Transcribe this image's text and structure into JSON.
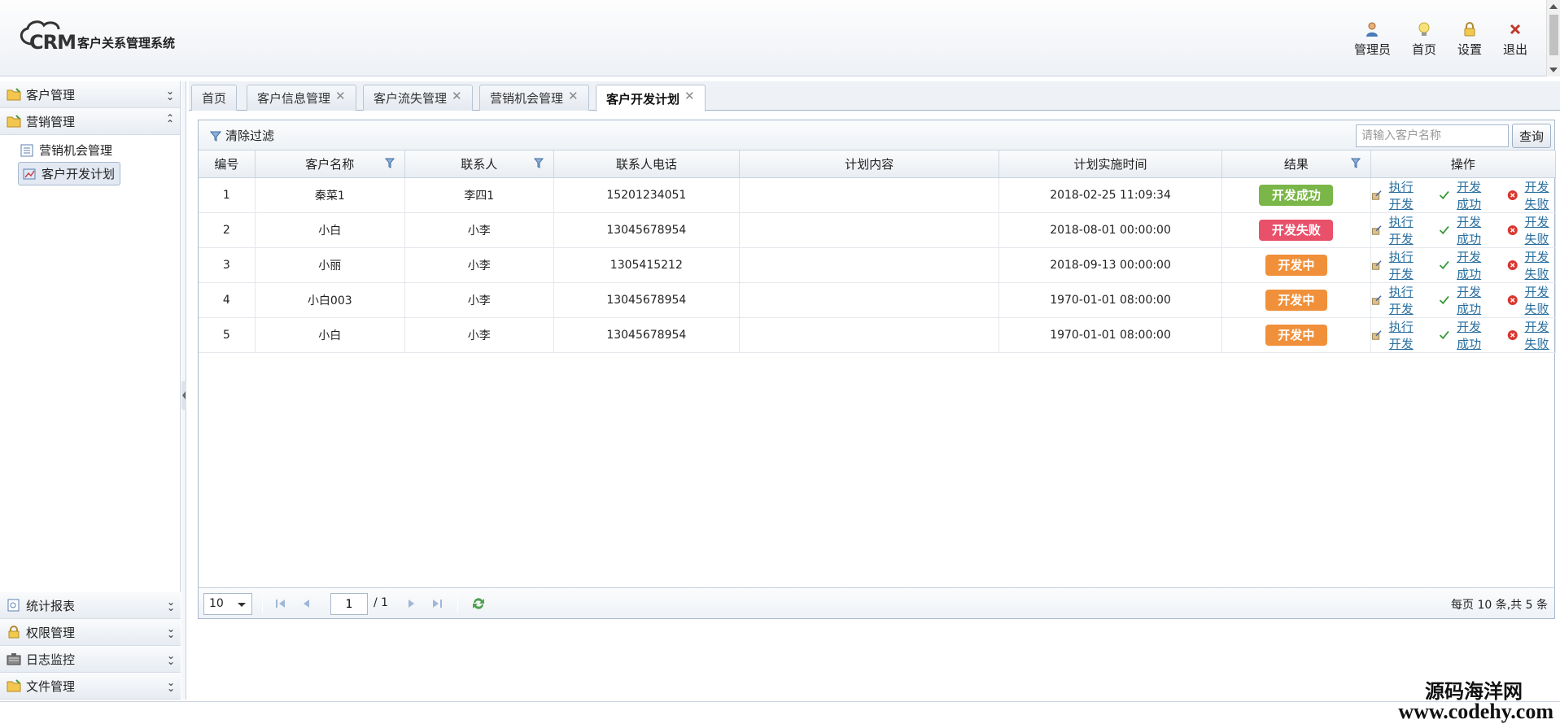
{
  "header": {
    "logo_text": "CRM",
    "system_title": "客户关系管理系统",
    "nav": [
      {
        "label": "管理员",
        "icon": "admin-user-icon"
      },
      {
        "label": "首页",
        "icon": "lightbulb-icon"
      },
      {
        "label": "设置",
        "icon": "lock-icon"
      },
      {
        "label": "退出",
        "icon": "close-x-icon"
      }
    ]
  },
  "sidebar": {
    "groups_top": [
      {
        "label": "客户管理",
        "icon": "folder-icon",
        "expanded": false
      },
      {
        "label": "营销管理",
        "icon": "folder-icon",
        "expanded": true
      }
    ],
    "items": [
      {
        "label": "营销机会管理",
        "icon": "list-icon"
      },
      {
        "label": "客户开发计划",
        "icon": "plan-icon",
        "selected": true
      }
    ],
    "groups_bottom": [
      {
        "label": "统计报表",
        "icon": "report-icon"
      },
      {
        "label": "权限管理",
        "icon": "lock-icon"
      },
      {
        "label": "日志监控",
        "icon": "monitor-icon"
      },
      {
        "label": "文件管理",
        "icon": "folder-icon"
      }
    ]
  },
  "tabs": [
    {
      "label": "首页",
      "closable": false
    },
    {
      "label": "客户信息管理",
      "closable": true
    },
    {
      "label": "客户流失管理",
      "closable": true
    },
    {
      "label": "营销机会管理",
      "closable": true
    },
    {
      "label": "客户开发计划",
      "closable": true,
      "active": true
    }
  ],
  "toolbar": {
    "clear_filter_label": "清除过滤",
    "search_placeholder": "请输入客户名称",
    "search_button": "查询"
  },
  "table": {
    "headers": [
      "编号",
      "客户名称",
      "联系人",
      "联系人电话",
      "计划内容",
      "计划实施时间",
      "结果",
      "操作"
    ],
    "rows": [
      {
        "id": "1",
        "name": "秦菜1",
        "contact": "李四1",
        "phone": "15201234051",
        "content": "",
        "time": "2018-02-25 11:09:34",
        "result": "开发成功",
        "result_color": "#7ab648"
      },
      {
        "id": "2",
        "name": "小白",
        "contact": "小李",
        "phone": "13045678954",
        "content": "",
        "time": "2018-08-01 00:00:00",
        "result": "开发失败",
        "result_color": "#e9506a"
      },
      {
        "id": "3",
        "name": "小丽",
        "contact": "小李",
        "phone": "1305415212",
        "content": "",
        "time": "2018-09-13 00:00:00",
        "result": "开发中",
        "result_color": "#f0903a"
      },
      {
        "id": "4",
        "name": "小白003",
        "contact": "小李",
        "phone": "13045678954",
        "content": "",
        "time": "1970-01-01 08:00:00",
        "result": "开发中",
        "result_color": "#f0903a"
      },
      {
        "id": "5",
        "name": "小白",
        "contact": "小李",
        "phone": "13045678954",
        "content": "",
        "time": "1970-01-01 08:00:00",
        "result": "开发中",
        "result_color": "#f0903a"
      }
    ],
    "ops": [
      "执行开发",
      "开发成功",
      "开发失败"
    ]
  },
  "pager": {
    "page_size": "10",
    "current_page": "1",
    "total_pages": "/ 1",
    "info": "每页 10 条,共 5 条"
  },
  "watermark": {
    "line1": "源码海洋网",
    "line2": "www.codehy.com"
  }
}
